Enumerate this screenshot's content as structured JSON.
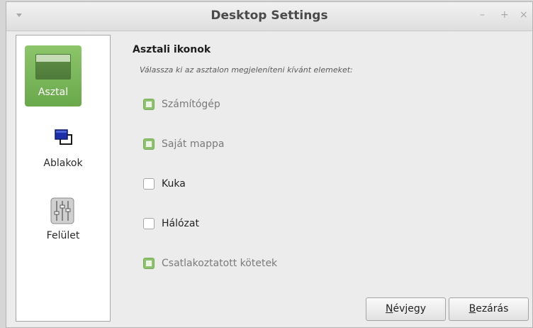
{
  "window": {
    "title": "Desktop Settings",
    "controls": {
      "minimize": "–",
      "maximize": "+",
      "close": "×"
    }
  },
  "sidebar": {
    "items": [
      {
        "label": "Asztal",
        "icon": "desktop-icon",
        "active": true
      },
      {
        "label": "Ablakok",
        "icon": "windows-icon",
        "active": false
      },
      {
        "label": "Felület",
        "icon": "mixer-icon",
        "active": false
      }
    ]
  },
  "main": {
    "title": "Asztali ikonok",
    "subtitle": "Válassza ki az asztalon megjeleníteni kívánt elemeket:",
    "options": [
      {
        "label": "Számítógép",
        "checked": true
      },
      {
        "label": "Saját mappa",
        "checked": true
      },
      {
        "label": "Kuka",
        "checked": false
      },
      {
        "label": "Hálózat",
        "checked": false
      },
      {
        "label": "Csatlakoztatott kötetek",
        "checked": true
      }
    ]
  },
  "buttons": {
    "about": {
      "mnemonic": "N",
      "rest": "évjegy"
    },
    "close": {
      "mnemonic": "B",
      "rest": "ezárás"
    }
  },
  "colors": {
    "accent": "#7cb85a",
    "checkbox_checked": "#8dc36c"
  }
}
